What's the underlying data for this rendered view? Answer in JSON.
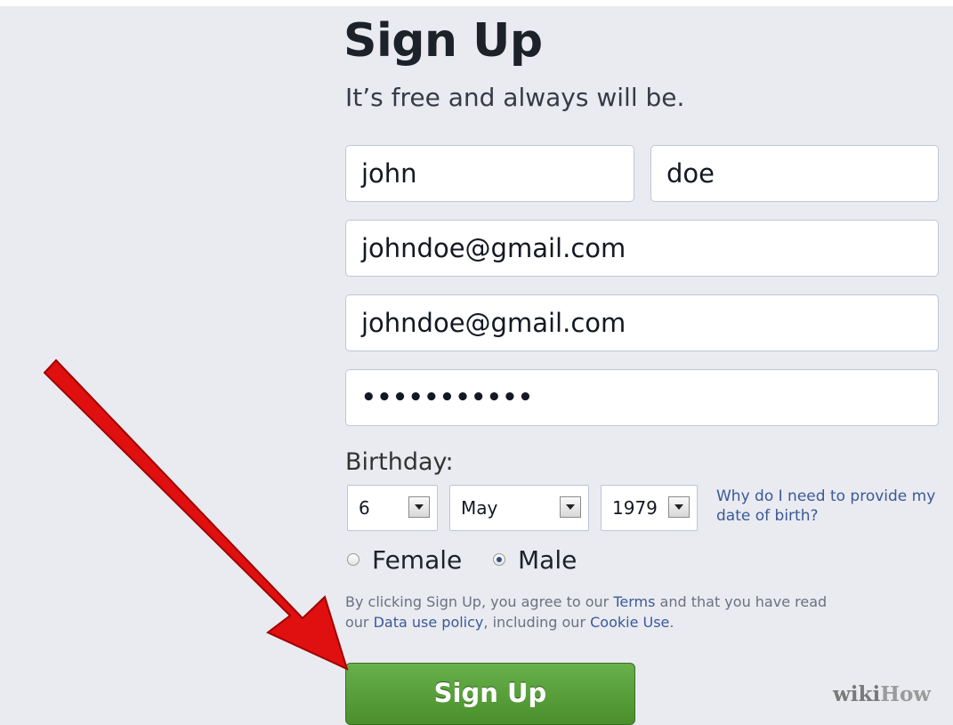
{
  "header": {
    "title": "Sign Up",
    "subtitle": "It’s free and always will be."
  },
  "form": {
    "first_name": "john",
    "last_name": "doe",
    "email": "johndoe@gmail.com",
    "email_confirm": "johndoe@gmail.com",
    "password_mask": "•••••••••••"
  },
  "birthday": {
    "label": "Birthday:",
    "day": "6",
    "month": "May",
    "year": "1979",
    "why_link": "Why do I need to provide my date of birth?"
  },
  "gender": {
    "female_label": "Female",
    "male_label": "Male",
    "selected": "Male"
  },
  "terms": {
    "text_1": "By clicking Sign Up, you agree to our ",
    "terms_link": "Terms",
    "text_2": " and that you have read our ",
    "data_policy_link": "Data use policy",
    "text_3": ", including our ",
    "cookie_link": "Cookie Use",
    "text_4": "."
  },
  "button": {
    "signup_label": "Sign Up"
  },
  "watermark": {
    "wiki": "wiki",
    "how": "How"
  },
  "colors": {
    "background": "#e9ebf0",
    "link": "#3b5998",
    "button_green": "#5aa03c",
    "arrow_red": "#e01010"
  }
}
